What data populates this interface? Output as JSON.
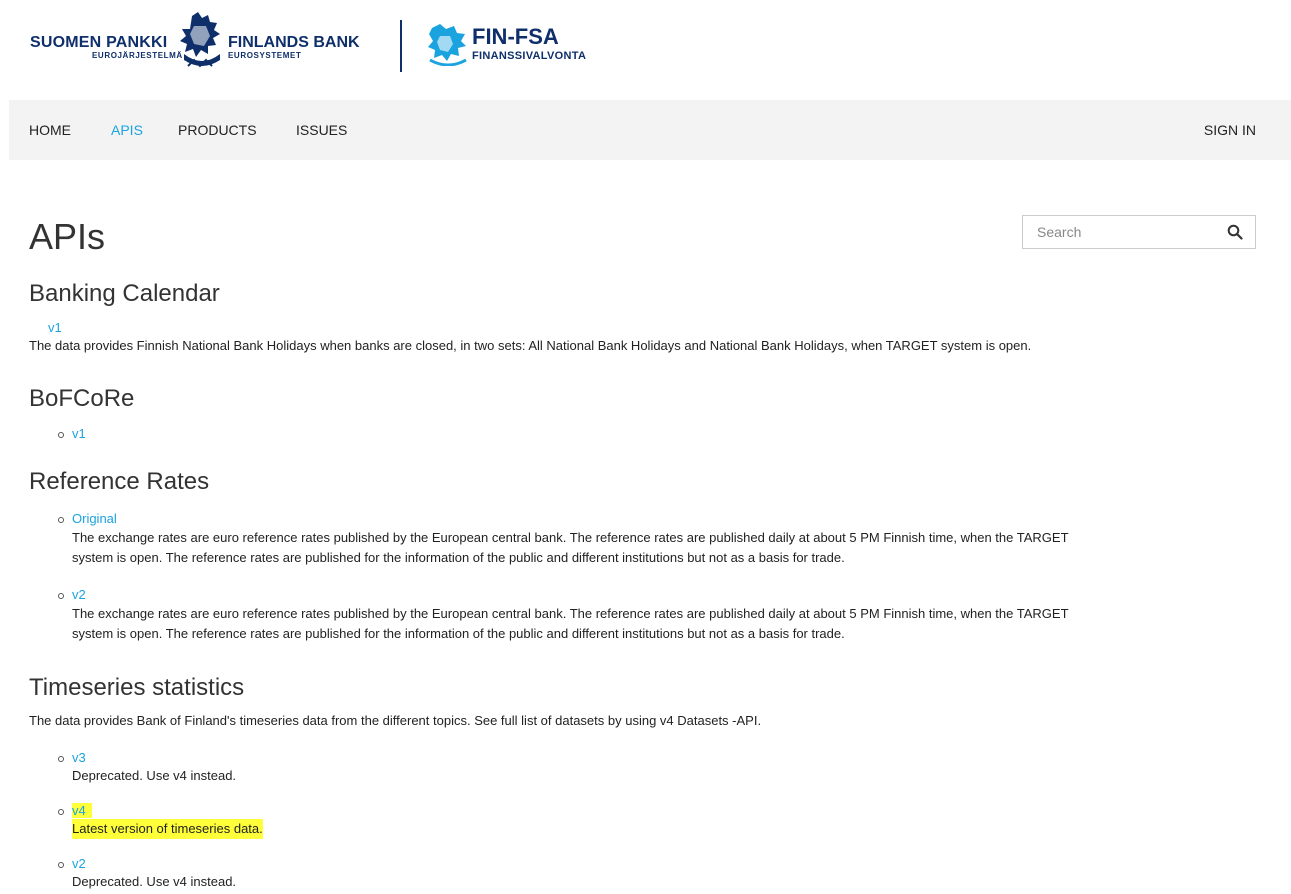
{
  "header": {
    "bof_fi": "SUOMEN PANKKI",
    "bof_fi_sub": "EUROJÄRJESTELMÄ",
    "bof_sv": "FINLANDS BANK",
    "bof_sv_sub": "EUROSYSTEMET",
    "fsa_title": "FIN-FSA",
    "fsa_sub": "FINANSSIVALVONTA"
  },
  "nav": {
    "items": [
      {
        "label": "HOME"
      },
      {
        "label": "APIS"
      },
      {
        "label": "PRODUCTS"
      },
      {
        "label": "ISSUES"
      }
    ],
    "active": "APIS",
    "signin": "SIGN IN"
  },
  "page": {
    "title": "APIs"
  },
  "search": {
    "placeholder": "Search"
  },
  "groups": {
    "banking_calendar": {
      "title": "Banking Calendar",
      "v1_label": "v1",
      "v1_desc": "The data provides Finnish National Bank Holidays when banks are closed, in two sets: All National Bank Holidays and National Bank Holidays, when TARGET system is open."
    },
    "bofcore": {
      "title": "BoFCoRe",
      "v1_label": "v1"
    },
    "reference_rates": {
      "title": "Reference Rates",
      "original_label": "Original",
      "original_desc_1": "The exchange rates are euro reference rates published by the European central bank. The reference rates are published daily at about 5 PM Finnish time, when the TARGET",
      "original_desc_2": "system is open. The reference rates are published for the information of the public and different institutions but not as a basis for trade.",
      "v2_label": "v2",
      "v2_desc_1": "The exchange rates are euro reference rates published by the European central bank. The reference rates are published daily at about 5 PM Finnish time, when the TARGET",
      "v2_desc_2": "system is open. The reference rates are published for the information of the public and different institutions but not as a basis for trade."
    },
    "timeseries": {
      "title": "Timeseries statistics",
      "intro": "The data provides Bank of Finland's timeseries data from the different topics. See full list of datasets by using v4 Datasets -API.",
      "v3_label": "v3",
      "v3_desc": "Deprecated. Use v4 instead.",
      "v4_label": "v4",
      "v4_desc": "Latest version of timeseries data.",
      "v2_label": "v2",
      "v2_desc": "Deprecated. Use v4 instead."
    }
  },
  "colors": {
    "link": "#1ba3e0",
    "brand_navy": "#0f2f6b",
    "highlight": "#ffff3a",
    "nav_bg": "#f3f3f3"
  },
  "icons": {
    "search": "search-icon",
    "lion": "lion-emblem-icon",
    "fsa_mark": "fin-fsa-emblem-icon"
  }
}
